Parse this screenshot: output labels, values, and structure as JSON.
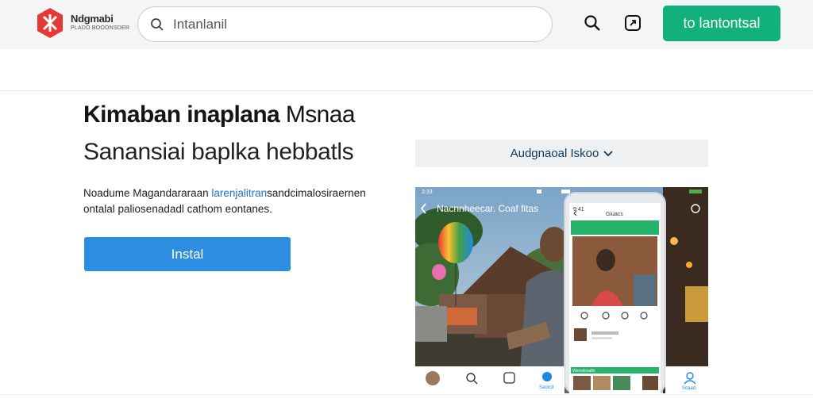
{
  "header": {
    "brand_name": "Ndgmabi",
    "brand_sub": "PLADO BOOONSDER",
    "search_value": "Intanlanil",
    "cta_label": "to lantontsal"
  },
  "hero": {
    "title_bold": "Kimaban inaplana",
    "title_light": " Msnaa",
    "subtitle": "Sanansiai baplka hebbatls",
    "desc_start": "Noadume Magandararaan ",
    "desc_link": "larenjalitran",
    "desc_end": "sandcimalosiraernen ontalal paliosenadadl cathom eontanes.",
    "install_label": "Instal"
  },
  "dropdown": {
    "label": "Audgnaoal Iskoo",
    "icon": "chevron-down-icon"
  },
  "screenshot": {
    "status_time": "3:33",
    "app_title": "Nacnnheecar. Coaf fitas",
    "nav_label_1": "Saoicd",
    "nav_label_2": "Scaad",
    "phone_status_time": "9:41",
    "phone_header": "Giuacs",
    "phone_label": "Wemslosaflo"
  },
  "colors": {
    "accent_green": "#12b07a",
    "accent_blue": "#2d8de0",
    "logo_red": "#e53935"
  }
}
